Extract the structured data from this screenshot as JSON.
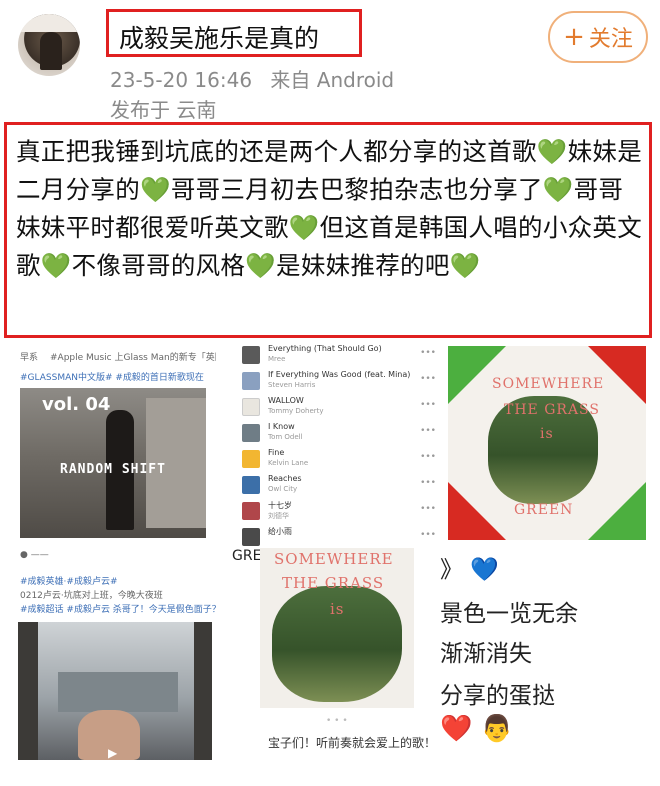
{
  "post": {
    "title": "成毅吴施乐是真的",
    "follow_label": "关注",
    "follow_icon": "plus-icon",
    "date": "23-5-20 16:46",
    "source": "来自 Android",
    "location": "发布于 云南",
    "body_segments": [
      "真正把我锤到坑底的还是两个人都分享的这首歌",
      "💚",
      "妹妹是二月分享的",
      "💚",
      "哥哥三月初去巴黎拍杂志也分享了",
      "💚",
      "哥哥妹妹平时都很爱听英文歌",
      "💚",
      "但这首是韩国人唱的小众英文歌",
      "💚",
      "不像哥哥的风格",
      "💚",
      "是妹妹推荐的吧",
      "💚"
    ]
  },
  "thumbs": {
    "t1": {
      "user": "早系",
      "line1": "#Apple Music 上Glass Man的新专「英国 Ran",
      "line2": "#GLASSMAN中文版# #成毅的首日新歌现在",
      "vol": "vol. 04",
      "overlay": "RANDOM SHIFT"
    },
    "t2": {
      "songs": [
        {
          "title": "Everything (That Should Go)",
          "artist": "Mree"
        },
        {
          "title": "If Everything Was Good (feat. Mina)",
          "artist": "Steven Harris"
        },
        {
          "title": "WALLOW",
          "artist": "Tommy Doherty"
        },
        {
          "title": "I Know",
          "artist": "Tom Odell"
        },
        {
          "title": "Fine",
          "artist": "Kelvin Lane"
        },
        {
          "title": "Reaches",
          "artist": "Owl City"
        },
        {
          "title": "十七岁",
          "artist": "刘德华"
        },
        {
          "title": "给小雨",
          "artist": ""
        }
      ]
    },
    "t3": {
      "cover_text": [
        "SOMEWHERE",
        "THE GRASS",
        "is",
        "GREEN"
      ]
    },
    "t4": {
      "line1": "#成毅英雄·#成毅卢云#",
      "line2": "0212卢云·坑底对上班，今晚大夜班",
      "line3": "#成毅超话 #成毅卢云 杀哥了！今天是假色面子？ 出处"
    },
    "t5": {
      "cover_text": [
        "SOMEWHERE",
        "THE GRASS",
        "is",
        "GREEN"
      ],
      "caption": "宝子们！听前奏就会爱上的歌！"
    },
    "t6": {
      "lines": [
        "》 💙",
        "景色一览无余",
        "渐渐消失",
        "分享的蛋挞",
        "❤️ 👨"
      ]
    }
  },
  "colors": {
    "highlight_border": "#e02020",
    "follow_accent": "#e27b2e",
    "meta_gray": "#8a8a8a",
    "green_heart": "#3aa82e"
  }
}
